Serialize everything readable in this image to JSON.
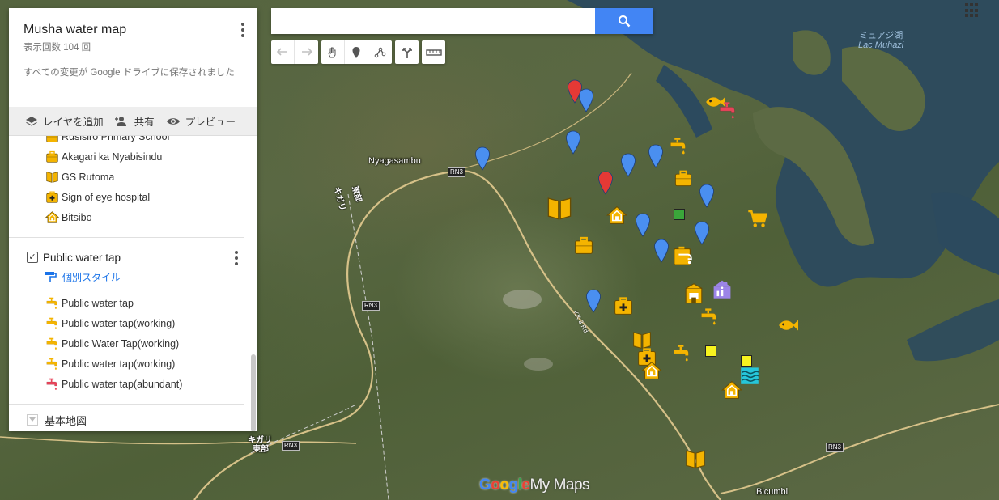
{
  "map": {
    "title": "Musha water map",
    "view_count": "表示回数 104 回",
    "save_note": "すべての変更が Google ドライブに保存されました",
    "actions": {
      "add_layer": "レイヤを追加",
      "share": "共有",
      "preview": "プレビュー"
    },
    "layer1_items": [
      {
        "label": "Rusisiro Primary School",
        "icon": "briefcase-icon"
      },
      {
        "label": "Akagari ka Nyabisindu",
        "icon": "briefcase-icon"
      },
      {
        "label": "GS Rutoma",
        "icon": "book-icon"
      },
      {
        "label": "Sign of eye hospital",
        "icon": "first-aid-icon"
      },
      {
        "label": "Bitsibo",
        "icon": "house-icon"
      }
    ],
    "layer2": {
      "name": "Public water tap",
      "checked": true,
      "style_link": "個別スタイル",
      "items": [
        {
          "label": "Public water tap",
          "icon": "water-tap-icon",
          "color": "#f4b400"
        },
        {
          "label": "Public water tap(working)",
          "icon": "water-tap-icon",
          "color": "#f4b400"
        },
        {
          "label": "Public Water Tap(working)",
          "icon": "water-tap-icon",
          "color": "#f4b400"
        },
        {
          "label": "Public water tap(working)",
          "icon": "water-tap-icon",
          "color": "#f4b400"
        },
        {
          "label": "Public water tap(abundant)",
          "icon": "water-tap-icon",
          "color": "#e8445a"
        }
      ]
    },
    "base_map": "基本地図"
  },
  "search": {
    "placeholder": ""
  },
  "labels": {
    "place_nyagasambu": "Nyagasambu",
    "place_bicumbi": "Bicumbi",
    "lake_ja": "ミュアジ湖",
    "lake_fr": "Lac Muhazi",
    "rn3_a": "RN3",
    "rn3_b": "RN3",
    "rn3_c": "RN3",
    "rn3_d": "RN3",
    "kk3": "KK 3 Rd",
    "kigali_1": "キガリ",
    "kigali_1b": "東部",
    "kigali_2": "キガリ",
    "kigali_2b": "東部"
  },
  "colors": {
    "yellow_marker": "#f4b400",
    "blue_pin": "#4a8ff0",
    "red_pin": "#e53935",
    "water_tap_red": "#e8445a",
    "green_square": "#3aa63a",
    "yellow_square": "#f7f31f",
    "purple_marker": "#9c84e8",
    "teal_marker": "#26c6da",
    "lake_water": "#2c4a5e"
  },
  "logo": {
    "google": "Google",
    "mymaps": "My Maps"
  }
}
